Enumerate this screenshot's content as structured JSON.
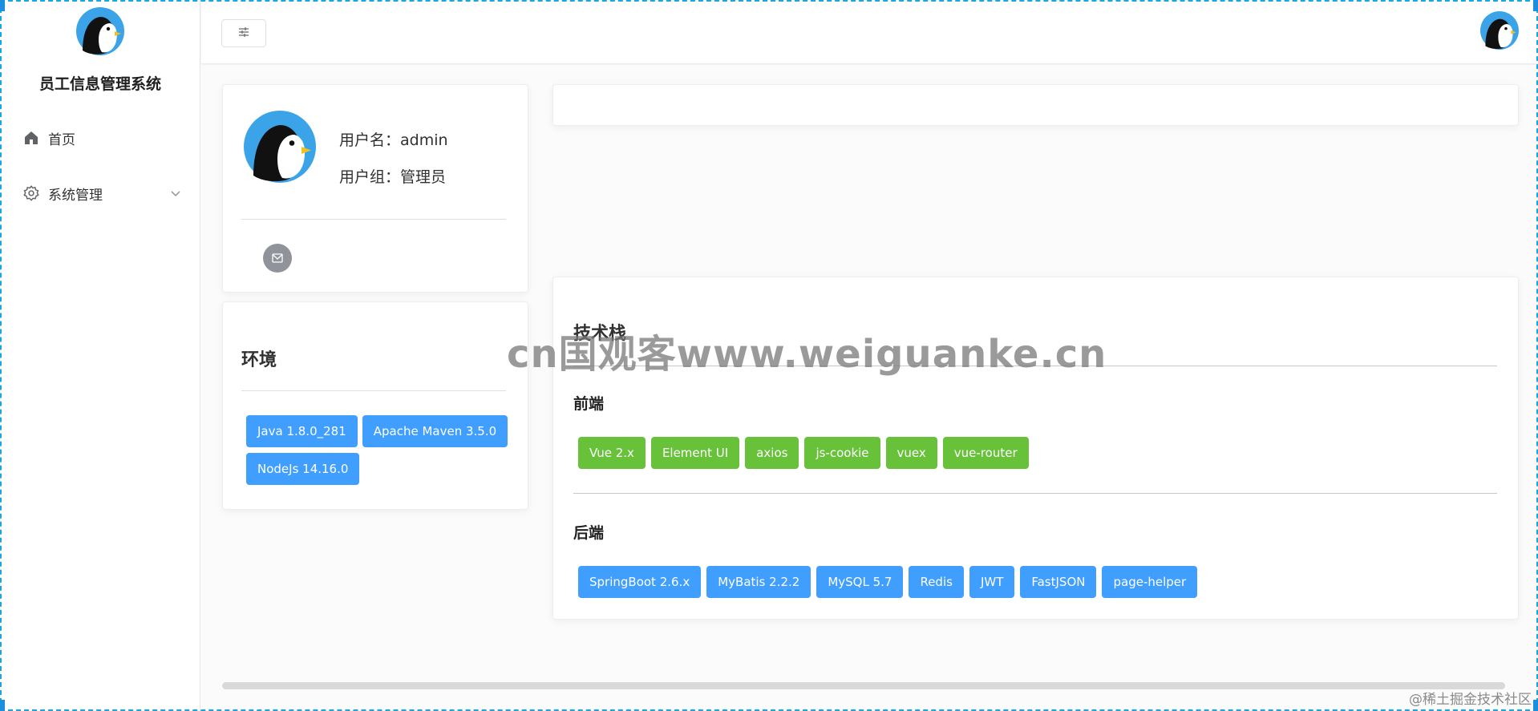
{
  "app": {
    "title": "员工信息管理系统"
  },
  "sidebar": {
    "items": [
      {
        "label": "首页",
        "icon": "home-icon"
      },
      {
        "label": "系统管理",
        "icon": "gear-icon",
        "expandable": true
      }
    ]
  },
  "header": {
    "toggle_icon": "sliders-icon",
    "avatar_icon": "penguin-avatar-icon"
  },
  "profile": {
    "username_label": "用户名：",
    "username": "admin",
    "group_label": "用户组：",
    "group": "管理员",
    "mail_icon": "mail-icon"
  },
  "environment": {
    "title": "环境",
    "tags": [
      "Java 1.8.0_281",
      "Apache Maven 3.5.0",
      "NodeJs 14.16.0"
    ]
  },
  "tech_stack": {
    "title": "技术栈",
    "frontend": {
      "title": "前端",
      "tags": [
        "Vue 2.x",
        "Element UI",
        "axios",
        "js-cookie",
        "vuex",
        "vue-router"
      ]
    },
    "backend": {
      "title": "后端",
      "tags": [
        "SpringBoot 2.6.x",
        "MyBatis 2.2.2",
        "MySQL 5.7",
        "Redis",
        "JWT",
        "FastJSON",
        "page-helper"
      ]
    }
  },
  "overlay": {
    "watermark": "cn国观客www.weiguanke.cn",
    "credit": "@稀土掘金技术社区"
  },
  "colors": {
    "tag_blue": "#409eff",
    "tag_green": "#67c23a",
    "avatar_blue": "#3ba3e8",
    "mail_gray": "#909399"
  }
}
